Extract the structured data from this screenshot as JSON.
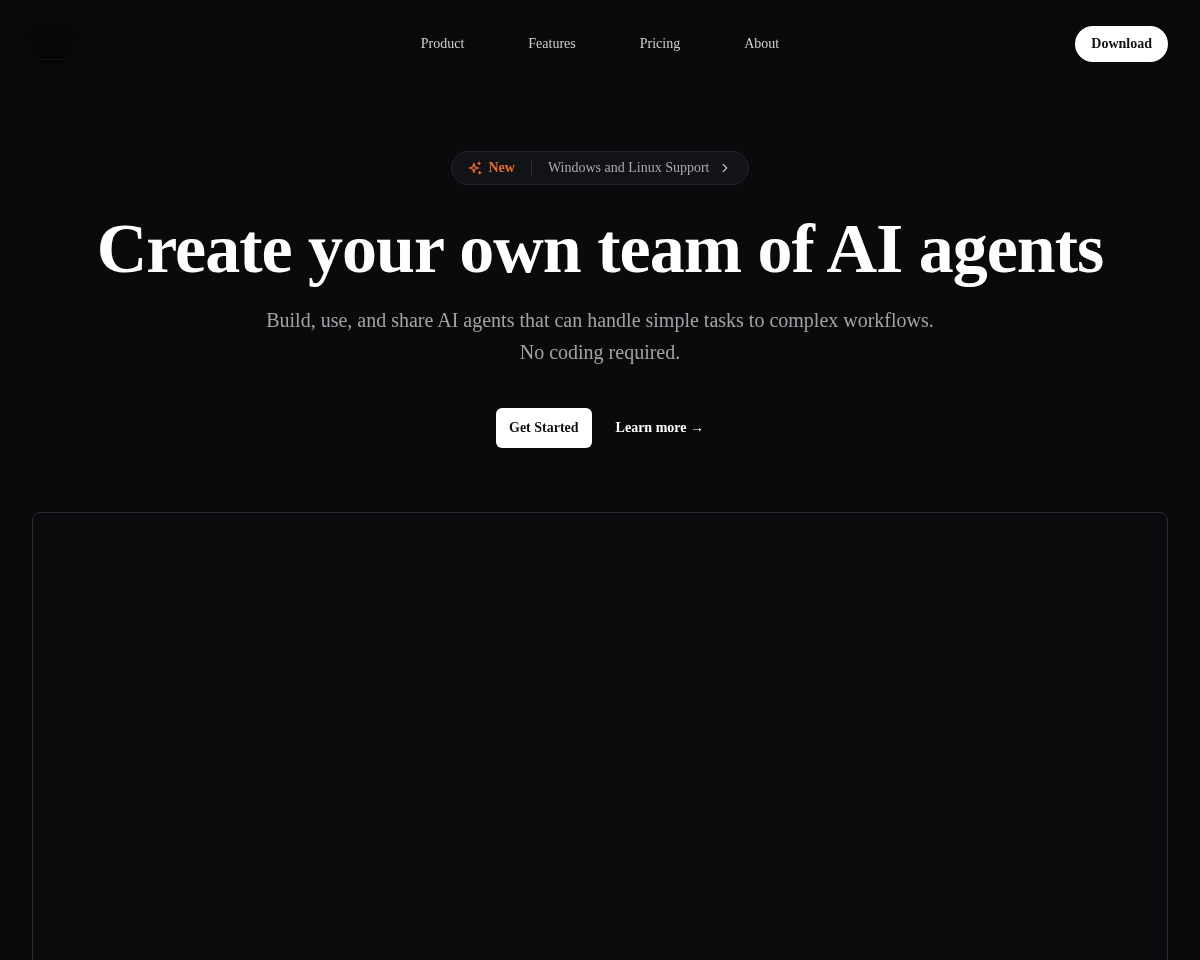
{
  "nav": {
    "links": [
      "Product",
      "Features",
      "Pricing",
      "About"
    ],
    "download": "Download"
  },
  "announcement": {
    "tag": "New",
    "text": "Windows and Linux Support"
  },
  "hero": {
    "title": "Create your own team of AI agents",
    "subtitle": [
      "Build, use, and share AI agents that can handle simple tasks to complex workflows.",
      "No coding required."
    ]
  },
  "actions": [
    {
      "kind": "primary",
      "label": "Get Started"
    },
    {
      "kind": "link",
      "label": "Learn more →"
    }
  ]
}
